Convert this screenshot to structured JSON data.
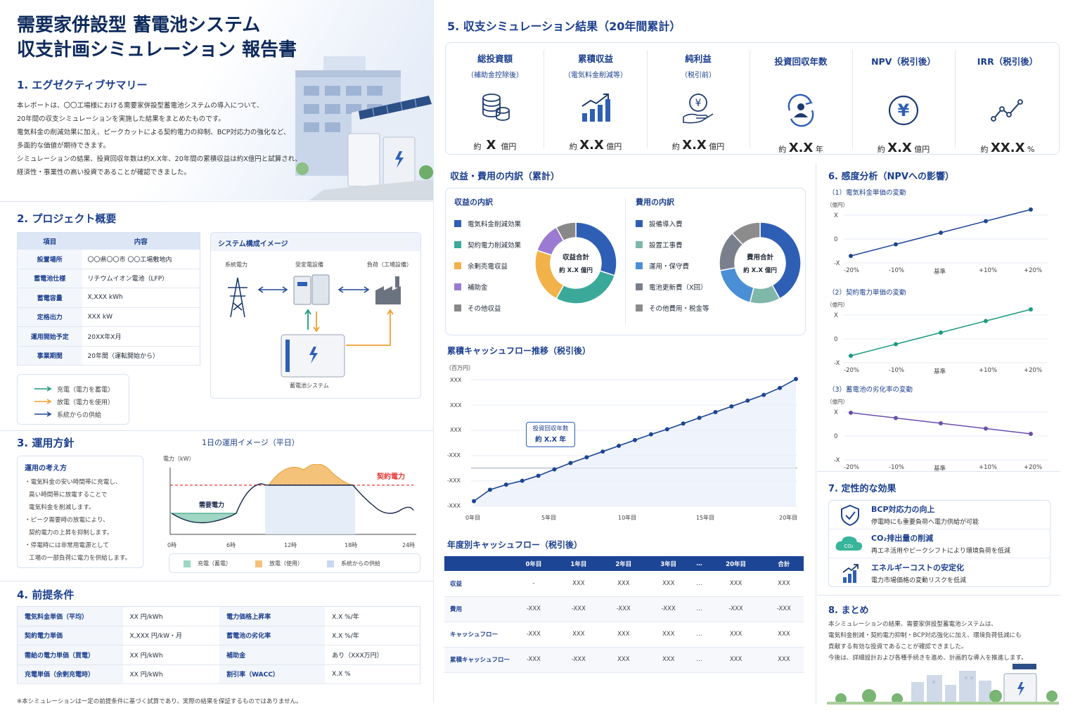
{
  "title": {
    "line1": "需要家併設型 蓄電池システム",
    "line2": "収支計画シミュレーション 報告書"
  },
  "s1": {
    "heading": "1. エグゼクティブサマリー",
    "lines": [
      "本レポートは、〇〇工場様における需要家併設型蓄電池システムの導入について、",
      "20年間の収支シミュレーションを実施した結果をまとめたものです。",
      "電気料金の削減効果に加え、ピークカットによる契約電力の抑制、BCP対応力の強化など、",
      "多面的な価値が期待できます。",
      "シミュレーションの結果、投資回収年数は約X.X年、20年間の累積収益は約X億円と試算され、",
      "経済性・事業性の高い投資であることが確認できました。"
    ]
  },
  "s2": {
    "heading": "2. プロジェクト概要",
    "th_item": "項目",
    "th_content": "内容",
    "rows": [
      {
        "k": "設置場所",
        "v": "〇〇県〇〇市 〇〇工場敷地内"
      },
      {
        "k": "蓄電池仕様",
        "v": "リチウムイオン電池（LFP）"
      },
      {
        "k": "蓄電容量",
        "v": "X,XXX kWh"
      },
      {
        "k": "定格出力",
        "v": "XXX kW"
      },
      {
        "k": "運用開始予定",
        "v": "20XX年X月"
      },
      {
        "k": "事業期間",
        "v": "20年間（運転開始から）"
      }
    ],
    "system_title": "システム構成イメージ",
    "grid": "系統電力",
    "substation": "受変電設備",
    "load": "負荷（工場設備）",
    "battery": "蓄電池システム",
    "legend": [
      "充電（電力を蓄電）",
      "放電（電力を使用）",
      "系統からの供給"
    ]
  },
  "s3": {
    "heading": "3. 運用方針",
    "box_title": "運用の考え方",
    "items": [
      [
        "・電気料金の安い時間帯に充電し、",
        "高い時間帯に放電することで",
        "電気料金を削減します。"
      ],
      [
        "・ピーク需要時の放電により、",
        "契約電力の上昇を抑制します。"
      ],
      [
        "・停電時には非常用電源として",
        "工場の一部負荷に電力を供給します。"
      ]
    ],
    "chart_title": "1日の運用イメージ（平日）",
    "y_label": "電力（kW）",
    "contract": "契約電力",
    "demand": "需要電力",
    "x_ticks": [
      "0時",
      "6時",
      "12時",
      "18時",
      "24時"
    ],
    "legend": [
      "充電（蓄電）",
      "放電（使用）",
      "系統からの供給"
    ]
  },
  "s4": {
    "heading": "4. 前提条件",
    "rows": [
      [
        "電気料金単価（平均）",
        "XX 円/kWh",
        "電力価格上昇率",
        "X.X %/年"
      ],
      [
        "契約電力単価",
        "X,XXX 円/kW・月",
        "蓄電池の劣化率",
        "X.X %/年"
      ],
      [
        "需給の電力単価（買電）",
        "XX 円/kWh",
        "補助金",
        "あり（XXX万円）"
      ],
      [
        "充電単価（余剰充電時）",
        "XX 円/kWh",
        "割引率（WACC）",
        "X.X %"
      ]
    ],
    "note": "※本シミュレーションは一定の前提条件に基づく試算であり、実際の結果を保証するものではありません。"
  },
  "s5": {
    "heading": "5. 収支シミュレーション結果（20年間累計）",
    "kpis": [
      {
        "t": "総投資額",
        "s": "（補助金控除後）",
        "pre": "約",
        "val": "X",
        "unit": "億円"
      },
      {
        "t": "累積収益",
        "s": "（電気料金削減等）",
        "pre": "約",
        "val": "X.X",
        "unit": "億円"
      },
      {
        "t": "純利益",
        "s": "（税引前）",
        "pre": "約",
        "val": "X.X",
        "unit": "億円"
      },
      {
        "t": "投資回収年数",
        "s": "",
        "pre": "約",
        "val": "X.X",
        "unit": "年"
      },
      {
        "t": "NPV（税引後）",
        "s": "",
        "pre": "約",
        "val": "X.X",
        "unit": "億円"
      },
      {
        "t": "IRR（税引後）",
        "s": "",
        "pre": "約",
        "val": "XX.X",
        "unit": "%"
      }
    ]
  },
  "breakdown": {
    "heading": "収益・費用の内訳（累計）",
    "rev_title": "収益の内訳",
    "cost_title": "費用の内訳",
    "rev_center": "収益合計",
    "rev_center_v": "約 X.X 億円",
    "cost_center": "費用合計",
    "cost_center_v": "約 X.X 億円",
    "colors_rev": [
      "#2f5fb5",
      "#3aa99a",
      "#f2b24a",
      "#9b7bd1",
      "#888888"
    ],
    "colors_cost": [
      "#2f5fb5",
      "#7fb8a8",
      "#4a8fd6",
      "#7a7f8c",
      "#8c8c8c"
    ]
  },
  "cumcf": {
    "heading": "累積キャッシュフロー推移（税引後）",
    "unit": "（百万円）",
    "payback": "投資回収年数",
    "payback_v": "約 X.X 年",
    "y_ticks": [
      "XXX",
      "XXX",
      "XXX",
      "-XXX",
      "-XXX",
      "-XXX"
    ],
    "x_ticks": [
      "0年目",
      "5年目",
      "10年目",
      "15年目",
      "20年目"
    ]
  },
  "annual": {
    "heading": "年度別キャッシュフロー（税引後）",
    "head": [
      "",
      "0年目",
      "1年目",
      "2年目",
      "3年目",
      "…",
      "20年目",
      "合計"
    ],
    "rows": [
      [
        "収益",
        "-",
        "XXX",
        "XXX",
        "XXX",
        "…",
        "XXX",
        "XXX"
      ],
      [
        "費用",
        "-XXX",
        "-XXX",
        "-XXX",
        "-XXX",
        "…",
        "-XXX",
        "-XXX"
      ],
      [
        "キャッシュフロー",
        "-XXX",
        "XXX",
        "XXX",
        "XXX",
        "…",
        "XXX",
        "XXX"
      ],
      [
        "累積キャッシュフロー",
        "-XXX",
        "-XXX",
        "XXX",
        "XXX",
        "…",
        "XXX",
        "XXX"
      ]
    ]
  },
  "s6": {
    "heading": "6. 感度分析（NPVへの影響）",
    "unit": "（億円）",
    "y_ticks": [
      "X",
      "0",
      "-X"
    ],
    "x_ticks": [
      "-20%",
      "-10%",
      "基準",
      "+10%",
      "+20%"
    ],
    "subs": [
      "（1）電気料金単価の変動",
      "（2）契約電力単価の変動",
      "（3）蓄電池の劣化率の変動"
    ]
  },
  "s7": {
    "heading": "7. 定性的な効果",
    "items": [
      {
        "t": "BCP対応力の向上",
        "d": "停電時にも重要負荷へ電力供給が可能"
      },
      {
        "t": "CO₂排出量の削減",
        "d": "再エネ活用やピークシフトにより環境負荷を低減"
      },
      {
        "t": "エネルギーコストの安定化",
        "d": "電力市場価格の変動リスクを低減"
      }
    ]
  },
  "s8": {
    "heading": "8. まとめ",
    "lines": [
      "本シミュレーションの結果、需要家併設型蓄電池システムは、",
      "電気料金削減・契約電力抑制・BCP対応強化に加え、環境負荷低減にも",
      "貢献する有効な投資であることが確認できました。",
      "今後は、詳細設計および各種手続きを進め、計画的な導入を推進します。"
    ]
  },
  "chart_data": [
    {
      "type": "pie",
      "title": "収益の内訳",
      "labels": [
        "電気料金削減効果",
        "契約電力削減効果",
        "余剰売電収益",
        "補助金",
        "その他収益"
      ],
      "values": [
        30,
        28,
        22,
        12,
        8
      ]
    },
    {
      "type": "pie",
      "title": "費用の内訳",
      "labels": [
        "設備導入費",
        "設置工事費",
        "運用・保守費",
        "電池更新費（X回）",
        "その他費用・税金等"
      ],
      "values": [
        42,
        12,
        18,
        16,
        12
      ]
    },
    {
      "type": "line",
      "title": "累積キャッシュフロー推移（税引後）",
      "x": [
        0,
        1,
        2,
        3,
        4,
        5,
        6,
        7,
        8,
        9,
        10,
        11,
        12,
        13,
        14,
        15,
        16,
        17,
        18,
        19,
        20
      ],
      "values": [
        -2.6,
        -1.7,
        -1.3,
        -1.0,
        -0.6,
        -0.1,
        0.4,
        0.85,
        1.3,
        1.75,
        2.2,
        2.65,
        3.05,
        3.5,
        3.95,
        4.4,
        4.85,
        5.3,
        5.75,
        6.3,
        7.0
      ]
    },
    {
      "type": "line",
      "title": "（1）電気料金単価の変動",
      "x": [
        "-20%",
        "-10%",
        "基準",
        "+10%",
        "+20%"
      ],
      "values": [
        -0.8,
        -0.25,
        0.3,
        0.85,
        1.4
      ]
    },
    {
      "type": "line",
      "title": "（2）契約電力単価の変動",
      "x": [
        "-20%",
        "-10%",
        "基準",
        "+10%",
        "+20%"
      ],
      "values": [
        -0.8,
        -0.25,
        0.3,
        0.85,
        1.4
      ]
    },
    {
      "type": "line",
      "title": "（3）蓄電池の劣化率の変動",
      "x": [
        "-20%",
        "-10%",
        "基準",
        "+10%",
        "+20%"
      ],
      "values": [
        1.1,
        0.85,
        0.6,
        0.35,
        0.1
      ]
    }
  ]
}
